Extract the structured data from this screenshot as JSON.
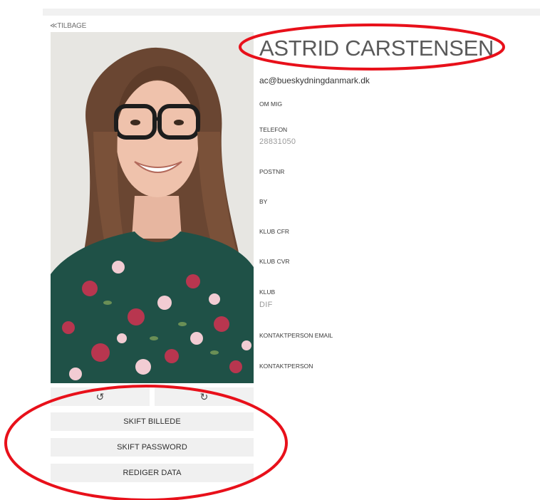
{
  "nav": {
    "back_label": "≪TILBAGE"
  },
  "profile": {
    "name": "ASTRID CARSTENSEN",
    "email": "ac@bueskydningdanmark.dk",
    "fields": [
      {
        "label": "OM MIG",
        "value": ""
      },
      {
        "label": "TELEFON",
        "value": "28831050"
      },
      {
        "label": "POSTNR",
        "value": ""
      },
      {
        "label": "BY",
        "value": ""
      },
      {
        "label": "KLUB CFR",
        "value": ""
      },
      {
        "label": "KLUB CVR",
        "value": ""
      },
      {
        "label": "KLUB",
        "value": "DIF"
      },
      {
        "label": "KONTAKTPERSON EMAIL",
        "value": ""
      },
      {
        "label": "KONTAKTPERSON",
        "value": ""
      }
    ]
  },
  "photo_controls": {
    "rotate_left_icon": "rotate-left-icon",
    "rotate_left_glyph": "↺",
    "rotate_right_icon": "rotate-right-icon",
    "rotate_right_glyph": "↻"
  },
  "actions": {
    "change_picture": "SKIFT BILLEDE",
    "change_password": "SKIFT PASSWORD",
    "edit_data": "REDIGER DATA"
  },
  "colors": {
    "annotation_red": "#e8101a",
    "button_bg": "#f0f0f0",
    "name_text": "#5a5a5a"
  }
}
